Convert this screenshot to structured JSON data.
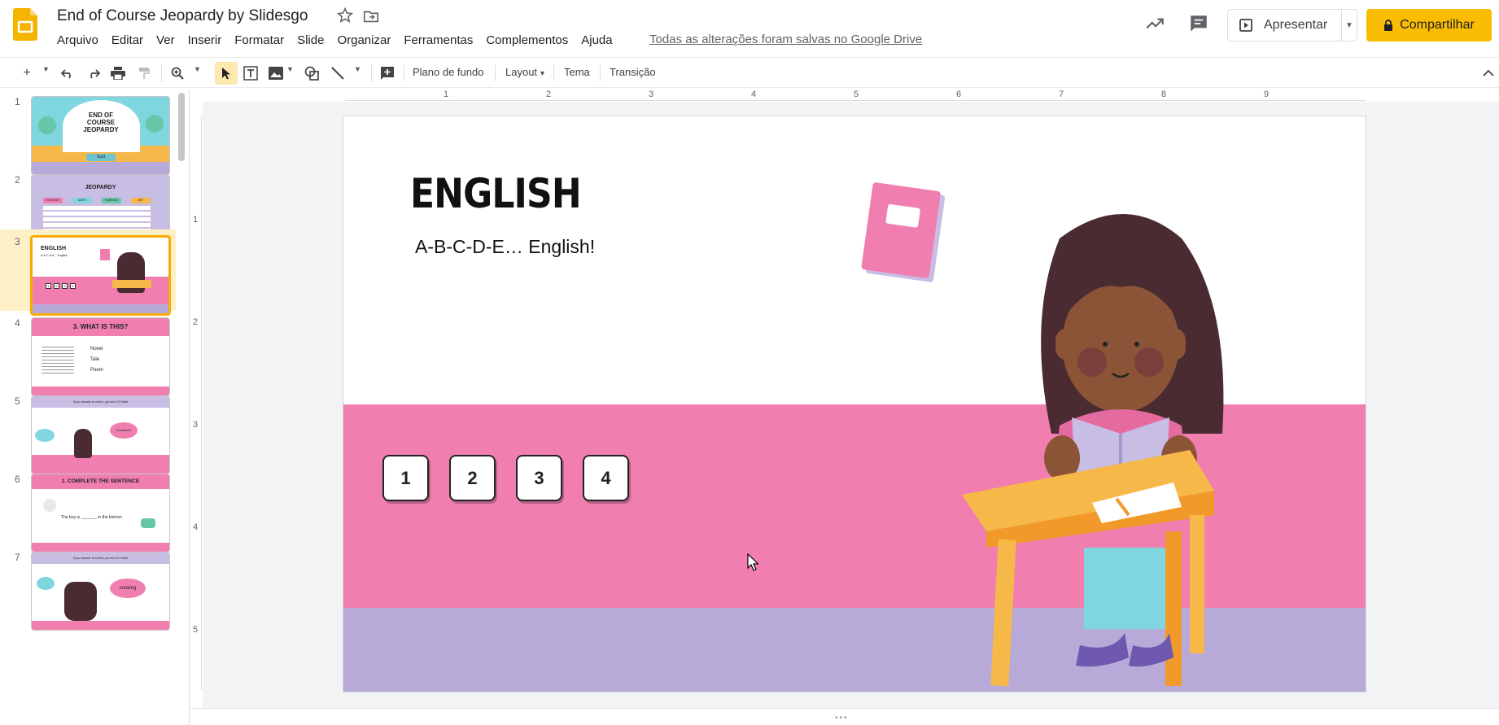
{
  "header": {
    "title": "End of Course Jeopardy by Slidesgo",
    "save_status": "Todas as alterações foram salvas no Google Drive",
    "present_label": "Apresentar",
    "share_label": "Compartilhar",
    "menu": [
      "Arquivo",
      "Editar",
      "Ver",
      "Inserir",
      "Formatar",
      "Slide",
      "Organizar",
      "Ferramentas",
      "Complementos",
      "Ajuda"
    ]
  },
  "toolbar": {
    "background_label": "Plano de fundo",
    "layout_label": "Layout",
    "theme_label": "Tema",
    "transition_label": "Transição"
  },
  "ruler": {
    "horizontal": [
      "1",
      "2",
      "3",
      "4",
      "5",
      "6",
      "7",
      "8",
      "9"
    ],
    "vertical": [
      "1",
      "2",
      "3",
      "4",
      "5"
    ]
  },
  "filmstrip": {
    "active": 3,
    "slides": [
      {
        "num": "1",
        "title": "END OF COURSE JEOPARDY",
        "button": "Start"
      },
      {
        "num": "2",
        "title": "JEOPARDY",
        "columns": [
          "ENGLISH",
          "MATH",
          "SCIENCE",
          "ART"
        ],
        "cell": "10 Points"
      },
      {
        "num": "3",
        "title": "ENGLISH",
        "subtitle": "A-B-C-D-E... English!",
        "buttons": [
          "1",
          "2",
          "3",
          "4"
        ]
      },
      {
        "num": "4",
        "title": "3. WHAT IS THIS?",
        "options": [
          "Novel",
          "Tale",
          "Poem"
        ]
      },
      {
        "num": "5",
        "title": "If your answer is correct, you win 10 Points!",
        "bubble": "Excellent!"
      },
      {
        "num": "6",
        "title": "1. COMPLETE THE SENTENCE",
        "body": "The boy is _______ in the kitchen"
      },
      {
        "num": "7",
        "title": "If your answer is correct, you win 10 Points!",
        "bubble": "cooking"
      }
    ]
  },
  "slide": {
    "title": "ENGLISH",
    "subtitle": "A-B-C-D-E… English!",
    "buttons": [
      "1",
      "2",
      "3",
      "4"
    ]
  },
  "colors": {
    "accent": "#fbbc04",
    "pink": "#f07fb0",
    "purple": "#b7a9d8",
    "active_thumb_bg": "#fef0c6"
  },
  "icons": [
    "slides-logo-icon",
    "star-icon",
    "folder-icon",
    "trend-icon",
    "comment-icon",
    "present-icon",
    "lock-icon"
  ]
}
